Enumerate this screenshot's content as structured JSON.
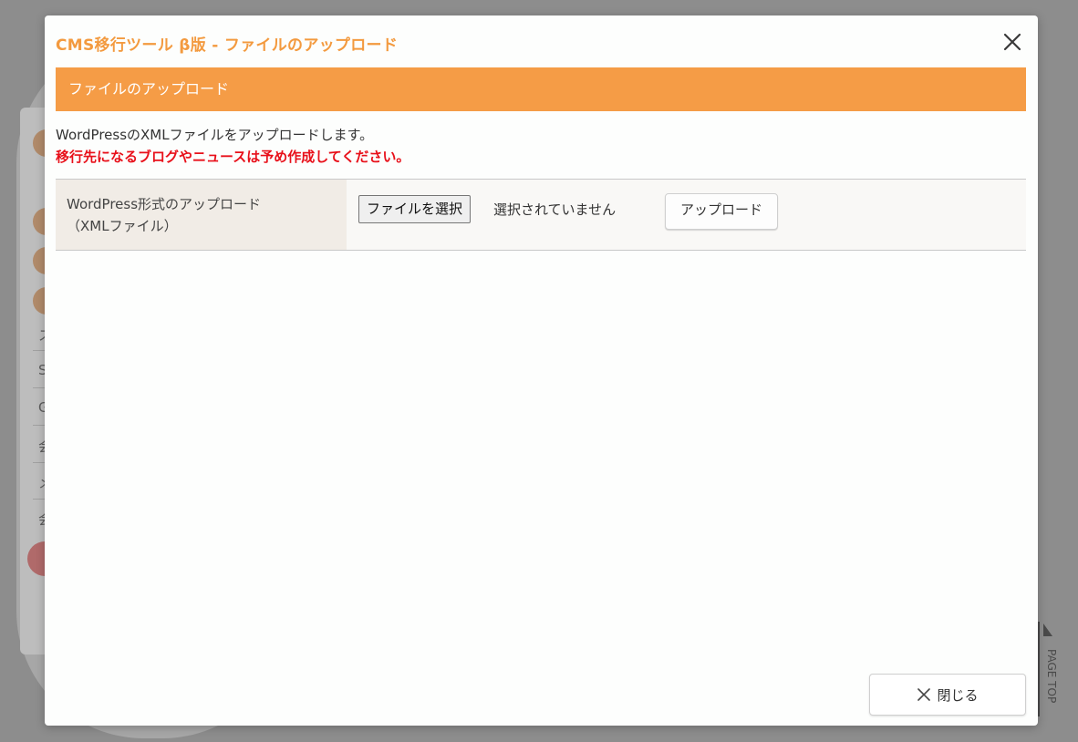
{
  "modal": {
    "title": "CMS移行ツール β版 - ファイルのアップロード",
    "close_icon": "close-icon",
    "section_header": "ファイルのアップロード",
    "description": "WordPressのXMLファイルをアップロードします。",
    "warning": "移行先になるブログやニュースは予め作成してください。",
    "form": {
      "label_line1": "WordPress形式のアップロード",
      "label_line2": "（XMLファイル）",
      "file_button": "ファイルを選択",
      "file_status": "選択されていません",
      "upload_button": "アップロード"
    },
    "footer": {
      "close_button": "閉じる"
    }
  },
  "background": {
    "letters": [
      "ス",
      "S",
      "G",
      "会",
      "メ",
      "会"
    ],
    "page_top": "PAGE TOP"
  },
  "colors": {
    "accent": "#f39a3f",
    "section_bar": "#f59c46",
    "warning": "#e8101a"
  }
}
